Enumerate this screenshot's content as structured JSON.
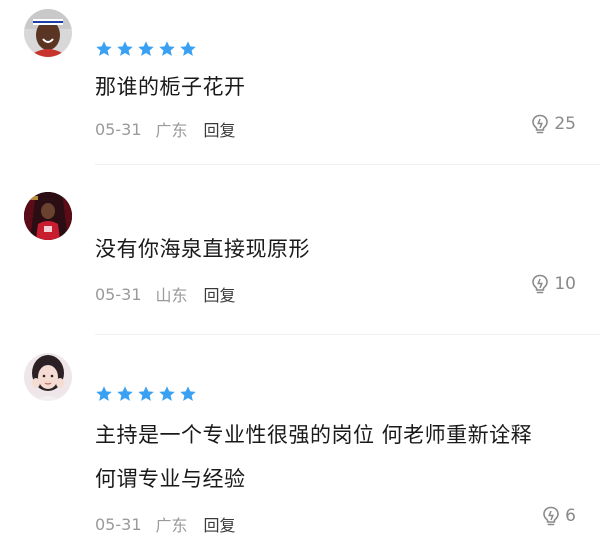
{
  "colors": {
    "star": "#3aa0f2",
    "meta": "#9a9a9a",
    "reply": "#3a3a3a",
    "text": "#1a1a1a"
  },
  "comments": [
    {
      "rating": 5,
      "text": "那谁的栀子花开",
      "date": "05-31",
      "location": "广东",
      "reply_label": "回复",
      "likes": "25",
      "like_icon": "like-lightbulb-icon"
    },
    {
      "rating": 0,
      "text": "没有你海泉直接现原形",
      "date": "05-31",
      "location": "山东",
      "reply_label": "回复",
      "likes": "10",
      "like_icon": "like-lightbulb-icon"
    },
    {
      "rating": 5,
      "text_line1": "主持是一个专业性很强的岗位 何老师重新诠释",
      "text_line2": "何谓专业与经验",
      "date": "05-31",
      "location": "广东",
      "reply_label": "回复",
      "likes": "6",
      "like_icon": "like-lightbulb-icon"
    }
  ]
}
